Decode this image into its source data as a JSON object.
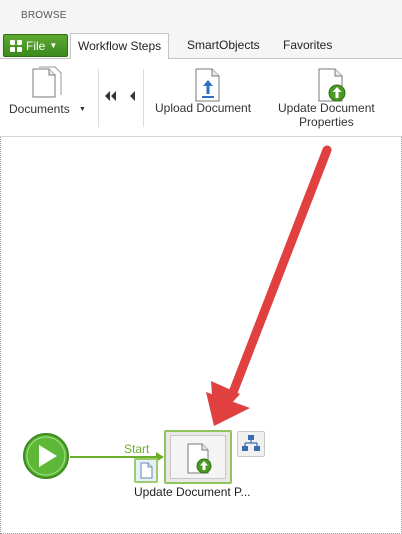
{
  "header": {
    "browse_label": "BROWSE"
  },
  "tabs": {
    "file_label": "File",
    "items": [
      {
        "label": "Workflow Steps",
        "active": true
      },
      {
        "label": "SmartObjects",
        "active": false
      },
      {
        "label": "Favorites",
        "active": false
      }
    ]
  },
  "ribbon": {
    "documents_label": "Documents",
    "upload_label": "Upload Document",
    "update_label_line1": "Update Document",
    "update_label_line2": "Properties"
  },
  "canvas": {
    "start_label": "Start",
    "node_label": "Update Document P..."
  },
  "colors": {
    "accent_green": "#4c9a26",
    "start_green": "#6aae2c",
    "arrow_red": "#e04040"
  }
}
